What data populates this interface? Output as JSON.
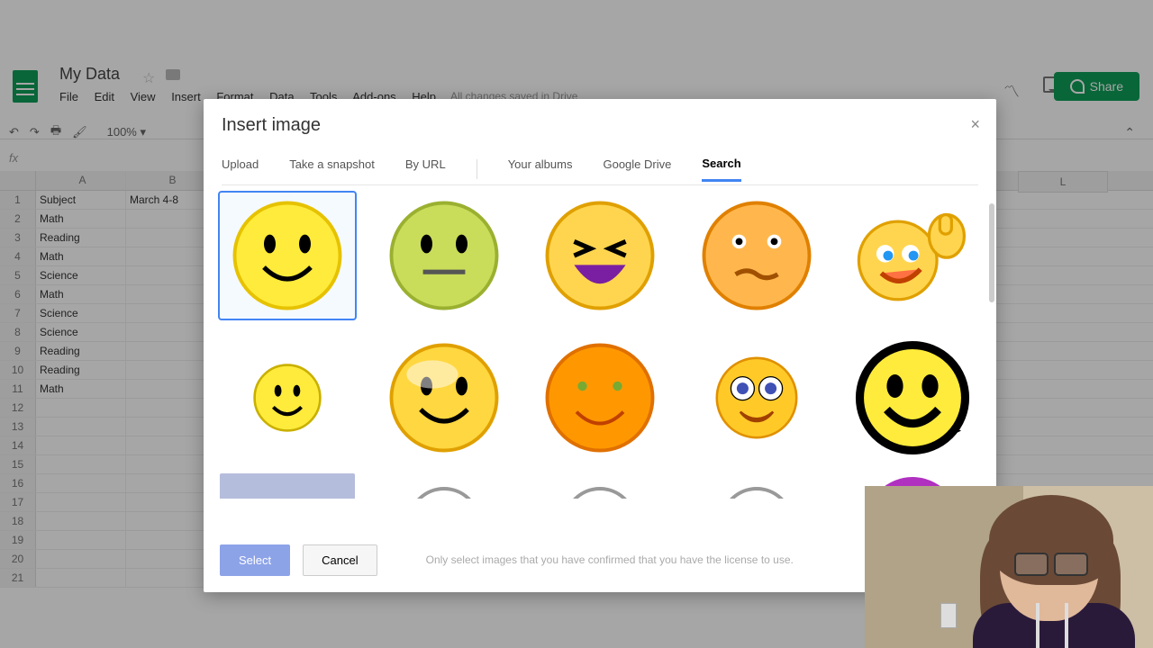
{
  "doc": {
    "title": "My Data",
    "saved": "All changes saved in Drive"
  },
  "menu": {
    "file": "File",
    "edit": "Edit",
    "view": "View",
    "insert": "Insert",
    "format": "Format",
    "data": "Data",
    "tools": "Tools",
    "addons": "Add-ons",
    "help": "Help"
  },
  "toolbar": {
    "zoom": "100%",
    "chevron": "⌃"
  },
  "share": {
    "label": "Share"
  },
  "sheet": {
    "columns": [
      "A",
      "B"
    ],
    "columnL": "L",
    "rows": [
      {
        "n": "1",
        "a": "Subject",
        "b": "March 4-8"
      },
      {
        "n": "2",
        "a": "Math",
        "b": ""
      },
      {
        "n": "3",
        "a": "Reading",
        "b": ""
      },
      {
        "n": "4",
        "a": "Math",
        "b": ""
      },
      {
        "n": "5",
        "a": "Science",
        "b": ""
      },
      {
        "n": "6",
        "a": "Math",
        "b": ""
      },
      {
        "n": "7",
        "a": "Science",
        "b": ""
      },
      {
        "n": "8",
        "a": "Science",
        "b": ""
      },
      {
        "n": "9",
        "a": "Reading",
        "b": ""
      },
      {
        "n": "10",
        "a": "Reading",
        "b": ""
      },
      {
        "n": "11",
        "a": "Math",
        "b": ""
      },
      {
        "n": "12",
        "a": "",
        "b": ""
      },
      {
        "n": "13",
        "a": "",
        "b": ""
      },
      {
        "n": "14",
        "a": "",
        "b": ""
      },
      {
        "n": "15",
        "a": "",
        "b": ""
      },
      {
        "n": "16",
        "a": "",
        "b": ""
      },
      {
        "n": "17",
        "a": "",
        "b": ""
      },
      {
        "n": "18",
        "a": "",
        "b": ""
      },
      {
        "n": "19",
        "a": "",
        "b": ""
      },
      {
        "n": "20",
        "a": "",
        "b": ""
      },
      {
        "n": "21",
        "a": "",
        "b": ""
      }
    ]
  },
  "modal": {
    "title": "Insert image",
    "close": "×",
    "tabs": {
      "upload": "Upload",
      "snapshot": "Take a snapshot",
      "byurl": "By URL",
      "albums": "Your albums",
      "drive": "Google Drive",
      "search": "Search",
      "active": "search"
    },
    "select": "Select",
    "cancel": "Cancel",
    "notice": "Only select images that you have confirmed that you have the license to use.",
    "results": [
      {
        "id": "smiley-classic",
        "selected": true
      },
      {
        "id": "smiley-neutral-green"
      },
      {
        "id": "smiley-laughing"
      },
      {
        "id": "smiley-confused-orange"
      },
      {
        "id": "smiley-thumbs-up"
      },
      {
        "id": "smiley-small-yellow"
      },
      {
        "id": "smiley-glossy-yellow"
      },
      {
        "id": "smiley-orange-grin"
      },
      {
        "id": "smiley-big-eyes"
      },
      {
        "id": "smiley-bold-black-outline"
      }
    ]
  }
}
